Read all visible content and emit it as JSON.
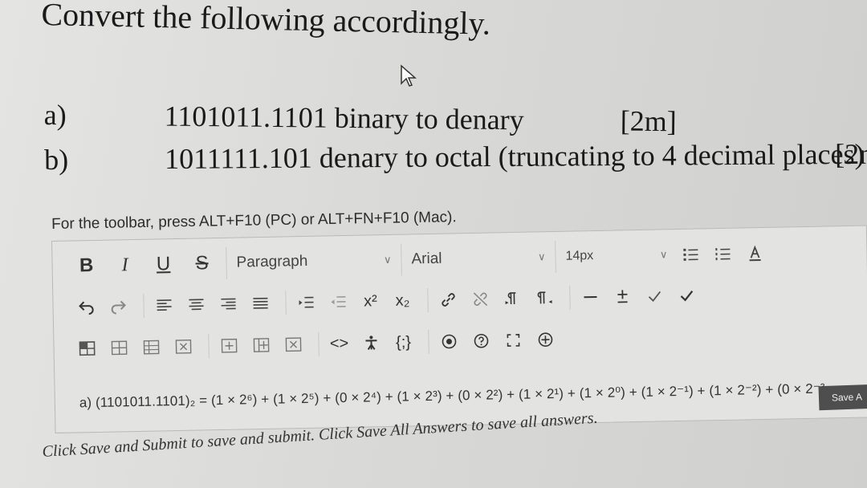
{
  "question": {
    "title": "Convert the following accordingly.",
    "items": [
      {
        "letter": "a)",
        "text": "1101011.1101 binary to denary",
        "marks": "[2m]"
      },
      {
        "letter": "b)",
        "text": "1011111.101 denary to octal  (truncating to 4 decimal places)",
        "marks": "[2m"
      }
    ]
  },
  "editor": {
    "toolbar_hint": "For the toolbar, press ALT+F10 (PC) or ALT+FN+F10 (Mac).",
    "format_buttons": {
      "bold": "B",
      "italic": "I",
      "underline": "U",
      "strike": "S"
    },
    "paragraph": "Paragraph",
    "font": "Arial",
    "size": "14px",
    "superscript": "x²",
    "subscript": "x₂",
    "code_label": "<>",
    "curly_label": "{;}",
    "content": "a) (1101011.1101)₂ = (1 × 2⁶) + (1 × 2⁵) + (0 × 2⁴) + (1 × 2³) + (0 × 2²) + (1 × 2¹) + (1 × 2⁰) + (1 × 2⁻¹) + (1 × 2⁻²) + (0 × 2⁻³"
  },
  "save_all_label": "Save A",
  "footer_hint": "Click Save and Submit to save and submit. Click Save All Answers to save all answers."
}
